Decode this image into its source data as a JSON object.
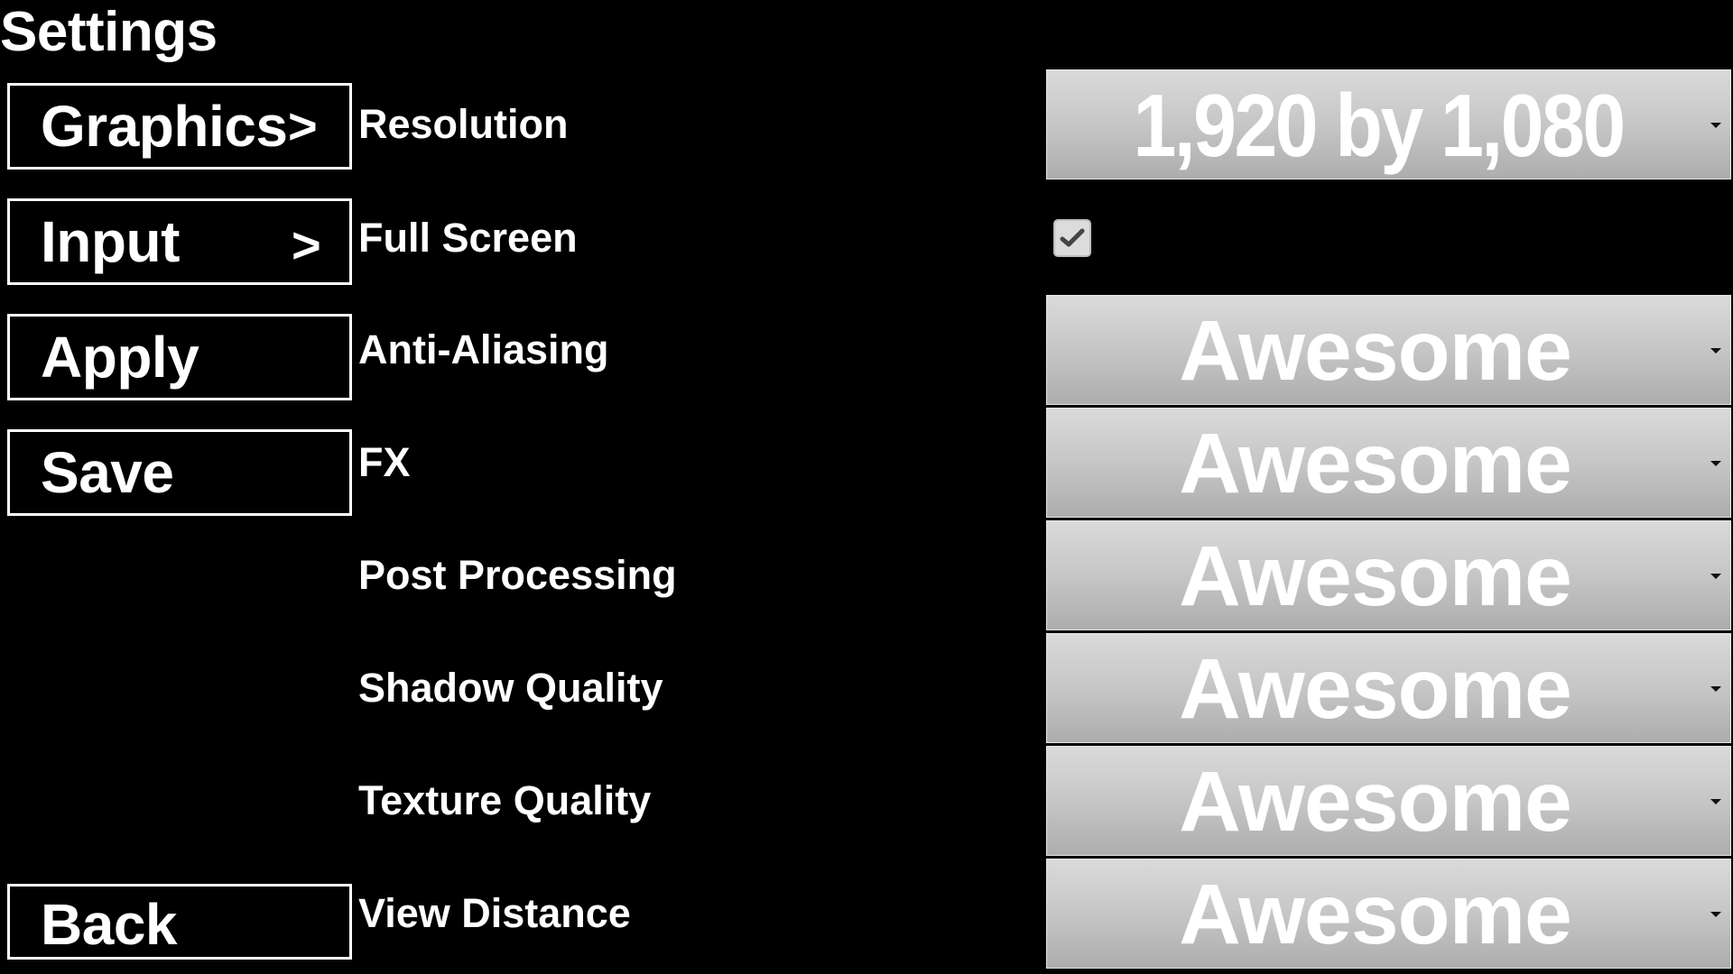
{
  "page": {
    "title": "Settings"
  },
  "nav": {
    "graphics": {
      "label": "Graphics",
      "chevron": ">"
    },
    "input": {
      "label": "Input",
      "chevron": ">"
    },
    "apply": {
      "label": "Apply"
    },
    "save": {
      "label": "Save"
    },
    "back": {
      "label": "Back"
    }
  },
  "settings": {
    "resolution": {
      "label": "Resolution",
      "value": "1,920 by 1,080"
    },
    "full_screen": {
      "label": "Full Screen",
      "checked": true,
      "icon": "checkmark-icon"
    },
    "anti_aliasing": {
      "label": "Anti-Aliasing",
      "value": "Awesome"
    },
    "fx": {
      "label": "FX",
      "value": "Awesome"
    },
    "post_processing": {
      "label": "Post Processing",
      "value": "Awesome"
    },
    "shadow_quality": {
      "label": "Shadow Quality",
      "value": "Awesome"
    },
    "texture_quality": {
      "label": "Texture Quality",
      "value": "Awesome"
    },
    "view_distance": {
      "label": "View Distance",
      "value": "Awesome"
    }
  },
  "icons": {
    "dropdown_arrow": "chevron-down-icon",
    "nav_chevron": "chevron-right-icon"
  },
  "colors": {
    "background": "#000000",
    "text": "#ffffff",
    "dropdown_top": "#dadada",
    "dropdown_bottom": "#adadad",
    "button_border": "#ffffff"
  }
}
